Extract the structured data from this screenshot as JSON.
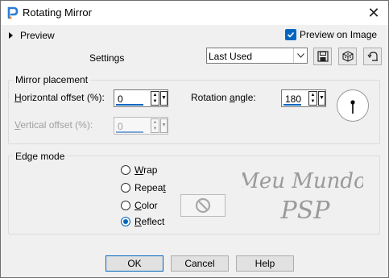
{
  "window": {
    "title": "Rotating Mirror"
  },
  "preview": {
    "toggle_label": "Preview",
    "preview_on_image_label": "Preview on Image",
    "preview_on_image_checked": true
  },
  "settings": {
    "label": "Settings",
    "preset_value": "Last Used"
  },
  "mirror_placement": {
    "title": "Mirror placement",
    "horizontal_offset": {
      "label_pre": "",
      "label_key": "H",
      "label_post": "orizontal offset (%):",
      "value": "0"
    },
    "vertical_offset": {
      "label_pre": "",
      "label_key": "V",
      "label_post": "ertical offset (%):",
      "value": "0",
      "disabled": true
    },
    "rotation_angle": {
      "label_pre": "Rotation ",
      "label_key": "a",
      "label_post": "ngle:",
      "value": "180"
    }
  },
  "edge_mode": {
    "title": "Edge mode",
    "options": [
      {
        "label_pre": "",
        "label_key": "W",
        "label_post": "rap",
        "selected": false
      },
      {
        "label_pre": "Repea",
        "label_key": "t",
        "label_post": "",
        "selected": false
      },
      {
        "label_pre": "",
        "label_key": "C",
        "label_post": "olor",
        "selected": false
      },
      {
        "label_pre": "",
        "label_key": "R",
        "label_post": "eflect",
        "selected": true
      }
    ]
  },
  "watermark": {
    "line1": "Meu Mundo",
    "line2": "PSP"
  },
  "buttons": {
    "ok": "OK",
    "cancel": "Cancel",
    "help": "Help"
  },
  "colors": {
    "accent": "#0067c0",
    "watermark": "#9a9a9a"
  }
}
